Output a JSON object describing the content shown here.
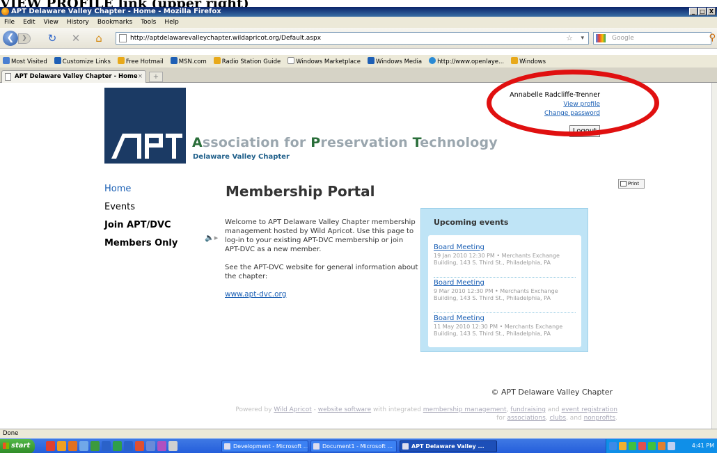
{
  "caption": "VIEW PROFILE link (upper right)",
  "window": {
    "title": "APT Delaware Valley Chapter - Home - Mozilla Firefox",
    "controls": [
      "_",
      "□",
      "X"
    ]
  },
  "menu": [
    "File",
    "Edit",
    "View",
    "History",
    "Bookmarks",
    "Tools",
    "Help"
  ],
  "navbar": {
    "url": "http://aptdelawarevalleychapter.wildapricot.org/Default.aspx",
    "search_placeholder": "Google"
  },
  "bookmarks": [
    "Most Visited",
    "Customize Links",
    "Free Hotmail",
    "MSN.com",
    "Radio Station Guide",
    "Windows Marketplace",
    "Windows Media",
    "http://www.openlaye...",
    "Windows"
  ],
  "tabs": [
    {
      "label": "APT Delaware Valley Chapter - Home"
    }
  ],
  "header": {
    "org_prefix_a": "A",
    "org_word_1": "ssociation for ",
    "org_prefix_p": "P",
    "org_word_2": "reservation ",
    "org_prefix_t": "T",
    "org_word_3": "echnology",
    "chapter": "Delaware Valley Chapter"
  },
  "user": {
    "name": "Annabelle Radcliffe-Trenner",
    "view_profile": "View profile",
    "change_password": "Change password",
    "logout": "Logout"
  },
  "print_label": "Print",
  "sidenav": [
    {
      "label": "Home"
    },
    {
      "label": "Events"
    },
    {
      "label": "Join APT/DVC"
    },
    {
      "label": "Members Only"
    }
  ],
  "main": {
    "title": "Membership Portal",
    "para1": "Welcome to APT Delaware Valley Chapter membership management hosted by Wild Apricot. Use this page to log-in to your existing APT-DVC membership or join APT-DVC as a new member.",
    "para2": "See the APT-DVC website for general information about the chapter:",
    "link": "www.apt-dvc.org"
  },
  "events": {
    "title": "Upcoming events",
    "items": [
      {
        "title": "Board Meeting",
        "detail": "19 Jan 2010 12:30 PM • Merchants Exchange Building, 143 S. Third St., Philadelphia, PA"
      },
      {
        "title": "Board Meeting",
        "detail": "9 Mar 2010 12:30 PM • Merchants Exchange Building, 143 S. Third St., Philadelphia, PA"
      },
      {
        "title": "Board Meeting",
        "detail": "11 May 2010 12:30 PM • Merchants Exchange Building, 143 S. Third St., Philadelphia, PA"
      }
    ]
  },
  "footer": {
    "copyright": "© APT Delaware Valley Chapter",
    "powered_by": "Powered by",
    "wild_apricot": "Wild Apricot",
    "dash": " - ",
    "website_software": "website software",
    "with_integrated": " with integrated ",
    "membership_management": "membership management",
    "comma1": ", ",
    "fundraising": "fundraising",
    "and1": " and ",
    "event_registration": "event registration",
    "for": "for ",
    "associations": "associations",
    "comma2": ", ",
    "clubs": "clubs",
    "and2": ", and ",
    "nonprofits": "nonprofits",
    "period": "."
  },
  "status": "Done",
  "taskbar": {
    "start": "start",
    "tasks": [
      {
        "label": "Development - Microsoft ..."
      },
      {
        "label": "Document1 - Microsoft ..."
      },
      {
        "label": "APT Delaware Valley ..."
      }
    ],
    "clock": "4:41 PM"
  },
  "colors": {
    "logo_bg": "#1b3a64",
    "accent_green": "#2a6e3a",
    "link_blue": "#1a5fb4",
    "events_bg": "#bfe4f6",
    "annotation_red": "#e01010"
  }
}
